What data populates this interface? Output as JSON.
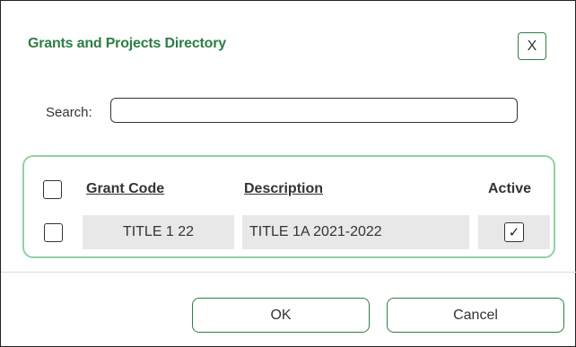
{
  "dialog": {
    "title": "Grants and Projects Directory",
    "close_label": "X"
  },
  "search": {
    "label": "Search:",
    "value": "",
    "placeholder": ""
  },
  "grid": {
    "columns": [
      "Grant Code",
      "Description",
      "Active"
    ],
    "rows": [
      {
        "grant_code": "TITLE 1 22",
        "description": "TITLE 1A 2021-2022",
        "active": "✓",
        "selected": false
      }
    ]
  },
  "footer": {
    "ok_label": "OK",
    "cancel_label": "Cancel"
  },
  "colors": {
    "title": "#2e7d44",
    "grid_border": "#8fd3a0",
    "button_border": "#2e7d44",
    "cell_background": "#e8e8e8"
  },
  "icons": {
    "active": "checkmark-icon"
  }
}
